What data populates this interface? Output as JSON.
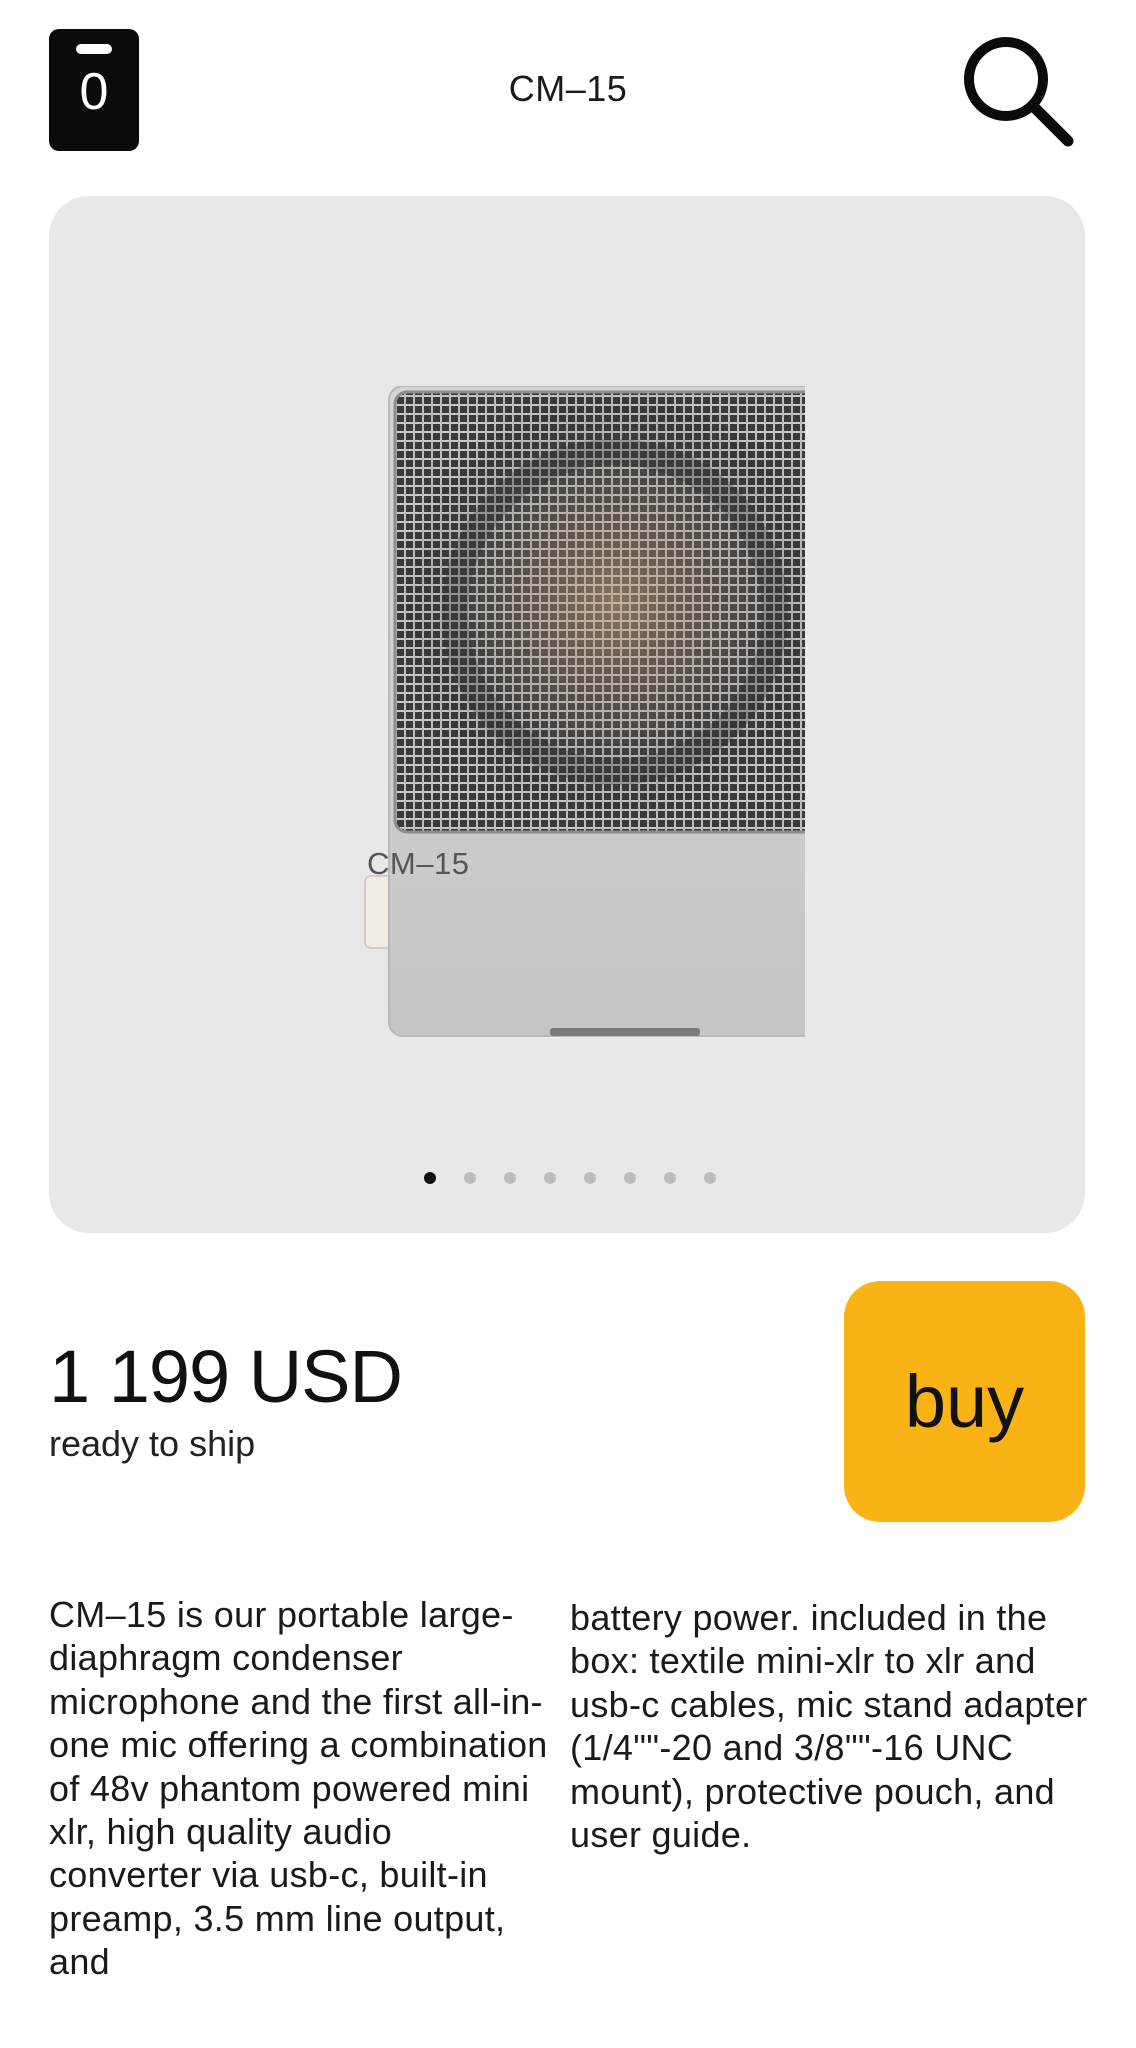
{
  "header": {
    "title": "CM–15",
    "cart_count": "0",
    "search_icon": "search-icon",
    "cart_icon": "cart-icon"
  },
  "gallery": {
    "model_label": "CM–15",
    "slide_count": 8,
    "active_slide": 1
  },
  "product": {
    "price": "1 199 USD",
    "status": "ready to ship",
    "buy_label": "buy"
  },
  "description": {
    "column_1": "CM–15 is our portable large-diaphragm condenser microphone and the first all-in-one mic offering a combination of 48v phantom powered mini xlr, high quality audio converter via usb-c, built-in preamp, 3.5 mm line output, and",
    "column_2": "battery power. included in the box: textile mini-xlr to xlr and usb-c cables, mic stand adapter (1/4\"\"-20 and 3/8\"\"-16 UNC mount), protective pouch, and user guide."
  },
  "colors": {
    "accent": "#fab314",
    "gallery_bg": "#e8e8e8",
    "text": "#111111"
  }
}
